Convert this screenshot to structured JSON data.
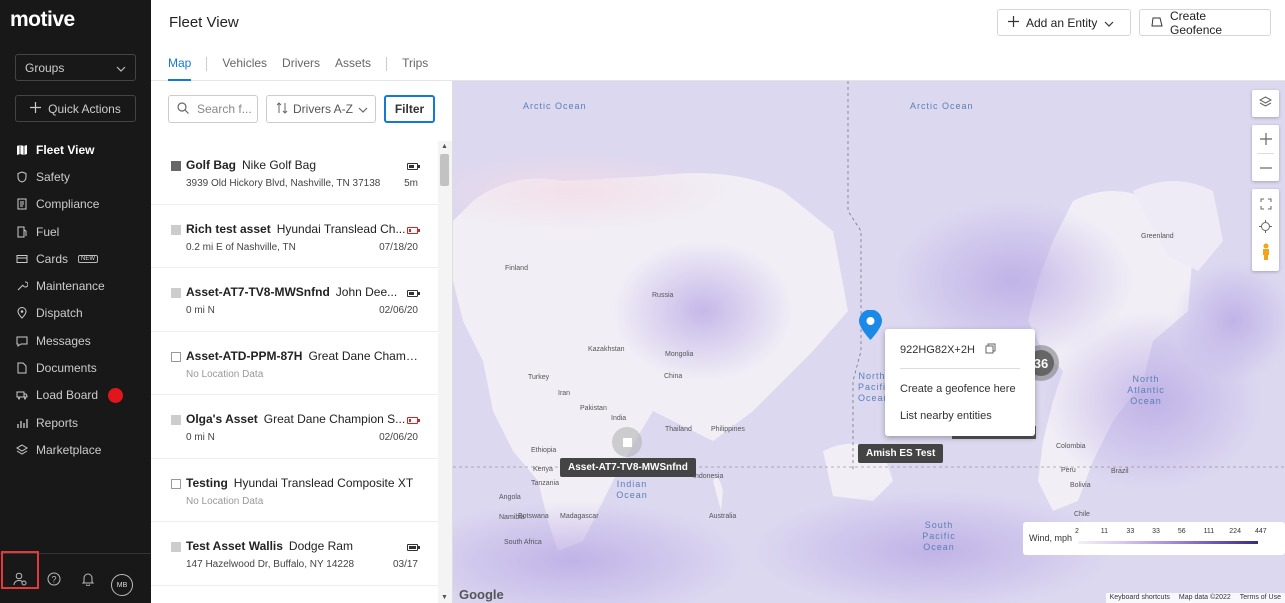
{
  "app": {
    "logo": "motive"
  },
  "sidebar": {
    "groups_label": "Groups",
    "quick_actions_label": "Quick Actions",
    "items": [
      {
        "label": "Fleet View",
        "icon": "map-icon",
        "active": true
      },
      {
        "label": "Safety",
        "icon": "shield-icon"
      },
      {
        "label": "Compliance",
        "icon": "document-icon"
      },
      {
        "label": "Fuel",
        "icon": "fuel-icon"
      },
      {
        "label": "Cards",
        "icon": "card-icon",
        "badge": "NEW"
      },
      {
        "label": "Maintenance",
        "icon": "wrench-icon"
      },
      {
        "label": "Dispatch",
        "icon": "pin-icon"
      },
      {
        "label": "Messages",
        "icon": "chat-icon"
      },
      {
        "label": "Documents",
        "icon": "file-icon"
      },
      {
        "label": "Load Board",
        "icon": "truck-icon",
        "dot_color": "#e0161c"
      },
      {
        "label": "Reports",
        "icon": "chart-icon"
      },
      {
        "label": "Marketplace",
        "icon": "layers-icon"
      }
    ],
    "avatar_initials": "MB"
  },
  "header": {
    "title": "Fleet View",
    "add_entity_label": "Add an Entity",
    "create_geofence_label": "Create Geofence",
    "tabs": [
      "Map",
      "Vehicles",
      "Drivers",
      "Assets",
      "Trips"
    ]
  },
  "list": {
    "search_placeholder": "Search f...",
    "sort_label": "Drivers A-Z",
    "filter_label": "Filter",
    "rows": [
      {
        "name": "Golf Bag",
        "desc": "Nike Golf Bag",
        "location": "3939 Old Hickory Blvd, Nashville, TN 37138",
        "time": "5m",
        "battery": "mid"
      },
      {
        "name": "Rich test asset",
        "desc": "Hyundai Translead Ch...",
        "location": "0.2 mi E of Nashville, TN",
        "time": "07/18/20",
        "battery": "low"
      },
      {
        "name": "Asset-AT7-TV8-MWSnfnd",
        "desc": "John Dee...",
        "location": "0 mi N",
        "time": "02/06/20",
        "battery": "mid"
      },
      {
        "name": "Asset-ATD-PPM-87H",
        "desc": "Great Dane Champi...",
        "location": "No Location Data",
        "time": "",
        "battery": "none"
      },
      {
        "name": "Olga's Asset",
        "desc": "Great Dane Champion S...",
        "location": "0 mi N",
        "time": "02/06/20",
        "battery": "low"
      },
      {
        "name": "Testing",
        "desc": "Hyundai Translead Composite XT",
        "location": "No Location Data",
        "time": "",
        "battery": "none"
      },
      {
        "name": "Test Asset Wallis",
        "desc": "Dodge Ram",
        "location": "147 Hazelwood Dr, Buffalo, NY 14228",
        "time": "03/17",
        "battery": "full"
      }
    ]
  },
  "map": {
    "oceans": [
      "Arctic Ocean",
      "Arctic Ocean",
      "North Pacific Ocean",
      "North Atlantic Ocean",
      "Indian Ocean",
      "South Pacific Ocean"
    ],
    "countries": [
      "Greenland",
      "Finland",
      "Russia",
      "Kazakhstan",
      "Mongolia",
      "China",
      "Turkey",
      "Iran",
      "Pakistan",
      "India",
      "Ethiopia",
      "Kenya",
      "Tanzania",
      "Angola",
      "Namibia",
      "Botswana",
      "South Africa",
      "Madagascar",
      "Indonesia",
      "Philippines",
      "Thailand",
      "Australia",
      "Colombia",
      "Peru",
      "Brazil",
      "Bolivia",
      "Chile"
    ],
    "context_menu": {
      "code": "922HG82X+2H",
      "create": "Create a geofence here",
      "nearby": "List nearby entities"
    },
    "cluster_count": "36",
    "labels": {
      "asset": "Asset-AT7-TV8-MWSnfnd",
      "vehicle": "Amish ES Test"
    },
    "legend": {
      "title": "Wind, mph",
      "ticks": [
        "2",
        "11",
        "33",
        "33",
        "56",
        "111",
        "224",
        "447"
      ]
    },
    "footer": [
      "Keyboard shortcuts",
      "Map data ©2022",
      "Terms of Use"
    ],
    "google": "Google"
  }
}
